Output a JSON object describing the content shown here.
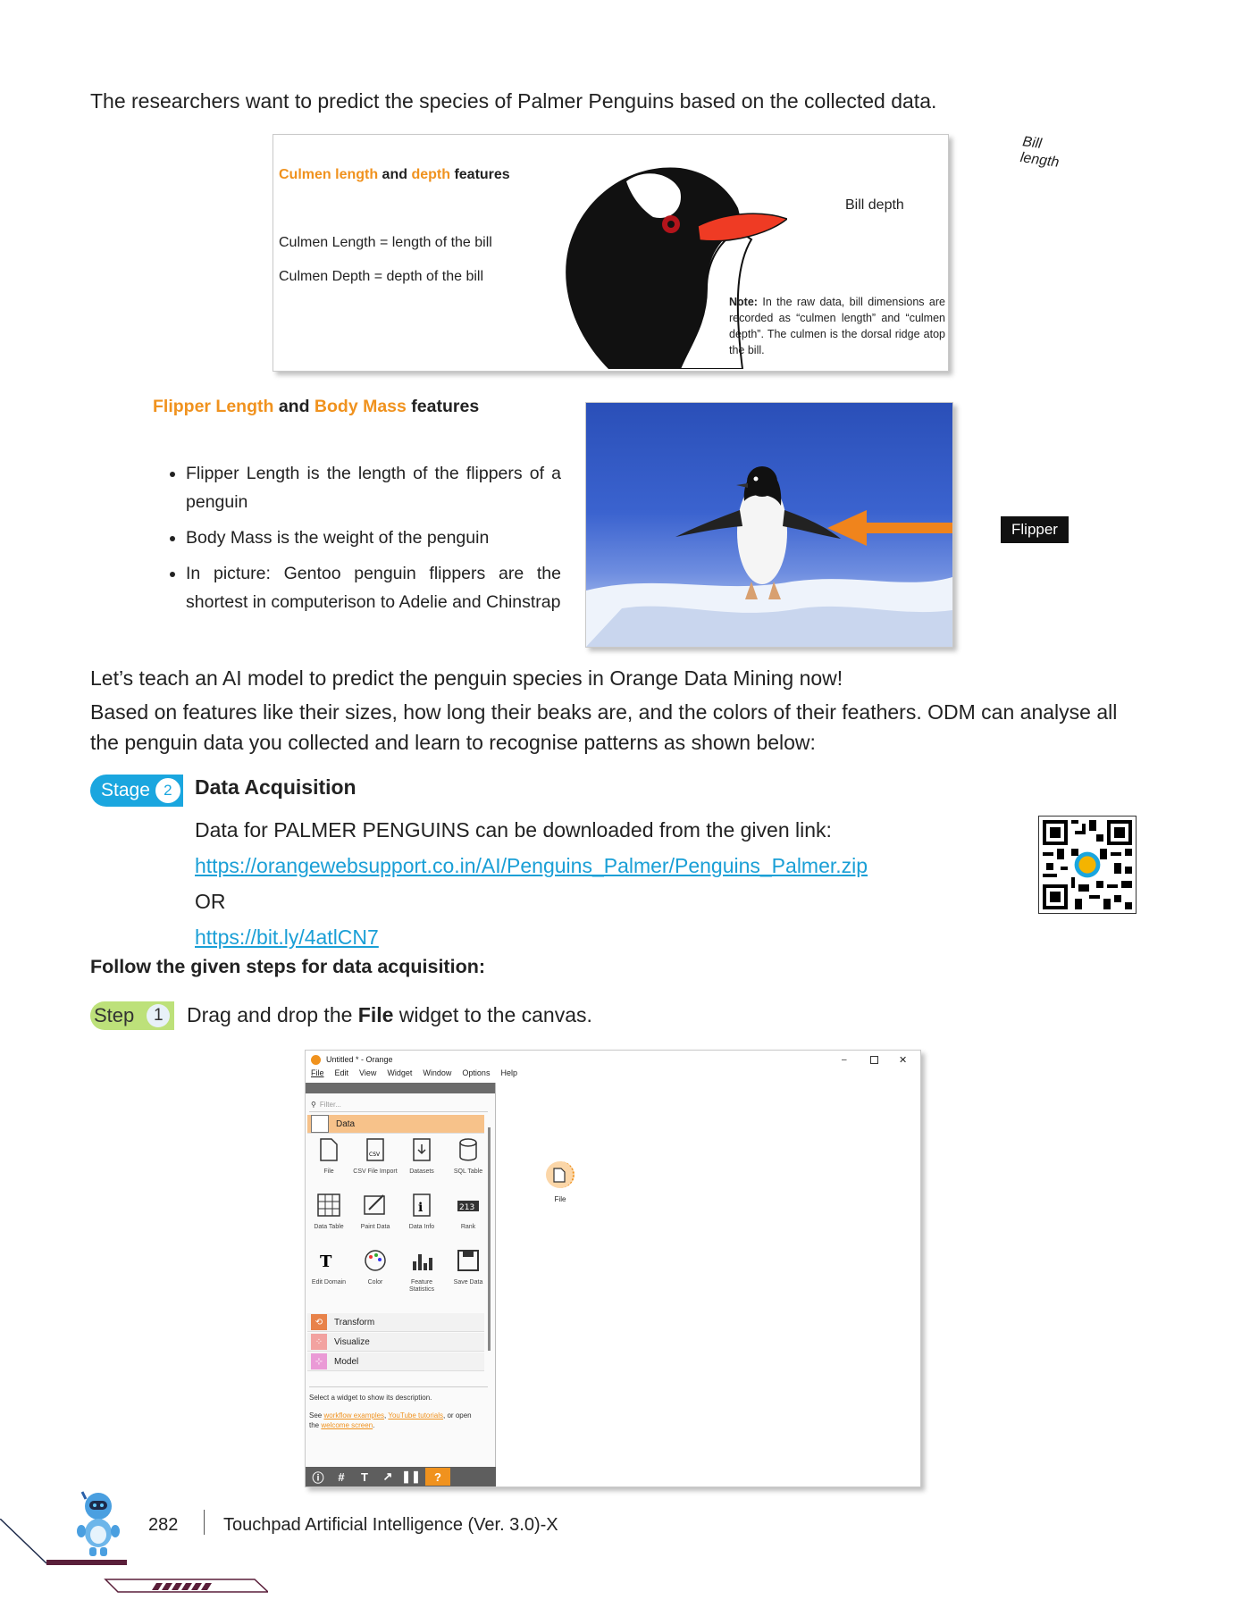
{
  "intro": "The researchers want to predict the species of Palmer Penguins based on the collected data.",
  "culmen_card": {
    "title_part1": "Culmen length",
    "title_and": " and ",
    "title_part2": "depth",
    "title_suffix": " features",
    "line1": "Culmen Length = length of the bill",
    "line2": "Culmen Depth = depth of the bill",
    "bill_length_label": "Bill length",
    "bill_depth_label": "Bill depth",
    "note_label": "Note:",
    "note_text": " In the raw data, bill dimensions are recorded as “culmen length” and “culmen depth”. The culmen is the dorsal ridge atop the bill."
  },
  "flipper_section": {
    "title_part1": "Flipper Length",
    "title_and": " and ",
    "title_part2": "Body Mass",
    "title_suffix": " features",
    "bullets": [
      "Flipper Length is the length of the flippers of a penguin",
      "Body Mass is the weight of the penguin",
      "In picture: Gentoo penguin flippers are the shortest in computerison to Adelie and Chinstrap"
    ],
    "flipper_label": "Flipper"
  },
  "teach_line": "Let’s teach an AI model to predict the penguin species in Orange Data Mining now!",
  "based_on": "Based on features like their sizes, how long their beaks are, and the colors of their feathers. ODM can analyse all the penguin data you collected and learn to recognise patterns as shown below:",
  "stage": {
    "label": "Stage",
    "number": "2",
    "title": "Data Acquisition",
    "download_text": "Data for PALMER PENGUINS can be downloaded from the given link:",
    "link1": "https://orangewebsupport.co.in/AI/Penguins_Palmer/Penguins_Palmer.zip",
    "or": "OR",
    "link2": "https://bit.ly/4atlCN7"
  },
  "follow_steps": "Follow the given steps for data acquisition:",
  "step": {
    "label": "Step",
    "number": "1",
    "text_prefix": "Drag and drop the ",
    "text_bold": "File",
    "text_suffix": " widget to the canvas."
  },
  "orange_window": {
    "title": "Untitled * - Orange",
    "menu": [
      "File",
      "Edit",
      "View",
      "Widget",
      "Window",
      "Options",
      "Help"
    ],
    "filter_placeholder": "Filter...",
    "data_category": "Data",
    "widgets": [
      [
        "File",
        "CSV File Import",
        "Datasets",
        "SQL Table"
      ],
      [
        "Data Table",
        "Paint Data",
        "Data Info",
        "Rank"
      ],
      [
        "Edit Domain",
        "Color",
        "Feature Statistics",
        "Save Data"
      ]
    ],
    "categories": [
      {
        "label": "Transform",
        "color": "#e8824a"
      },
      {
        "label": "Visualize",
        "color": "#f2a2a0"
      },
      {
        "label": "Model",
        "color": "#ea9ad6"
      }
    ],
    "desc_line1": "Select a widget to show its description.",
    "desc_see": "See ",
    "desc_link1": "workflow examples",
    "desc_comma": ", ",
    "desc_link2": "YouTube tutorials",
    "desc_or_open": ", or open",
    "desc_the": "the ",
    "desc_link3": "welcome screen",
    "desc_dot": ".",
    "canvas_widget_label": "File",
    "accent": "#f0921e"
  },
  "footer": {
    "page_number": "282",
    "book_title": "Touchpad Artificial Intelligence (Ver. 3.0)-X"
  }
}
